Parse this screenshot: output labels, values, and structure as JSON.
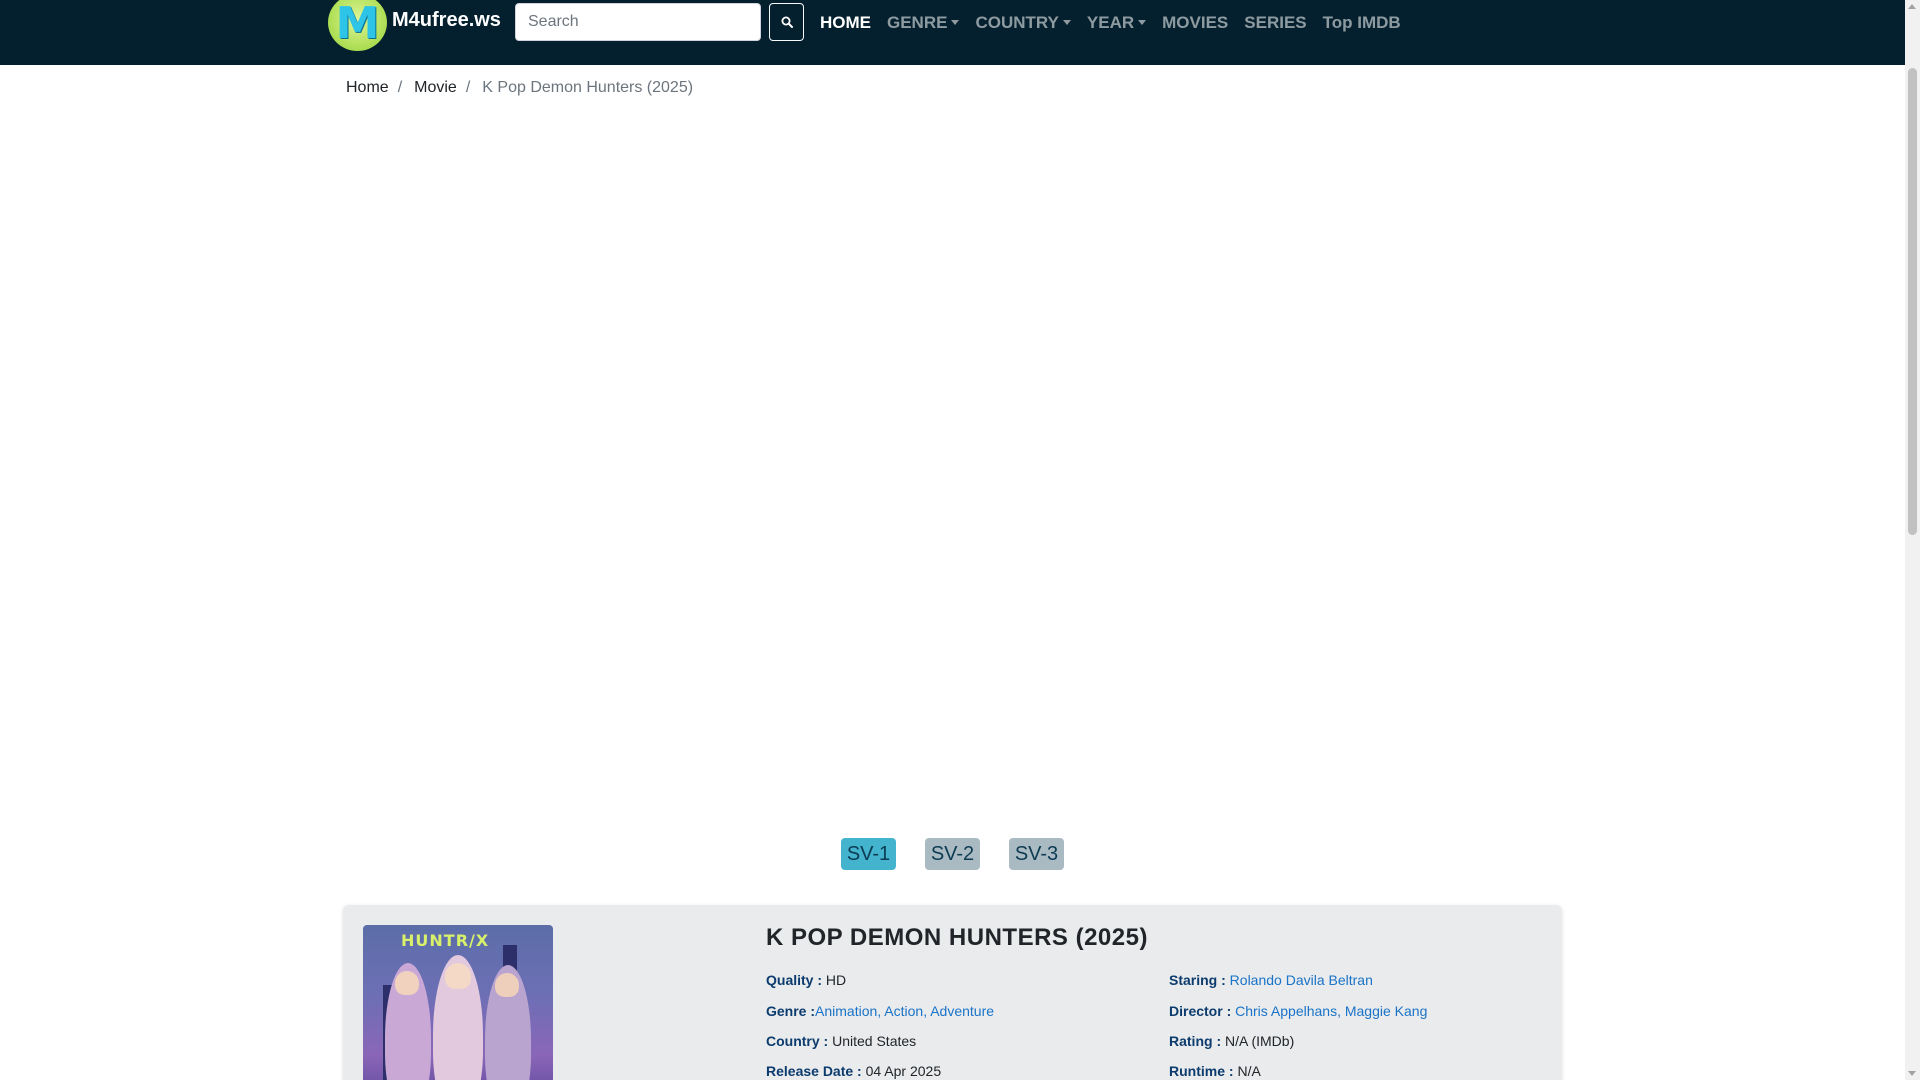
{
  "navbar": {
    "logo_letter": "M",
    "brand": "M4ufree.ws",
    "search_placeholder": "Search",
    "menu": [
      {
        "label": "HOME",
        "active": true,
        "dropdown": false
      },
      {
        "label": "GENRE",
        "active": false,
        "dropdown": true
      },
      {
        "label": "COUNTRY",
        "active": false,
        "dropdown": true
      },
      {
        "label": "YEAR",
        "active": false,
        "dropdown": true
      },
      {
        "label": "MOVIES",
        "active": false,
        "dropdown": false
      },
      {
        "label": "SERIES",
        "active": false,
        "dropdown": false
      },
      {
        "label": "Top IMDB",
        "active": false,
        "dropdown": false
      }
    ]
  },
  "breadcrumb": {
    "icon": "",
    "items": [
      "Home",
      "Movie",
      "K Pop Demon Hunters (2025)"
    ]
  },
  "servers": [
    "SV-1",
    "SV-2",
    "SV-3"
  ],
  "movie": {
    "poster_text": "HUNTR/X",
    "title": "K POP DEMON HUNTERS (2025)",
    "quality_label": "Quality :",
    "quality": "HD",
    "genre_label": "Genre :",
    "genre": "Animation, Action, Adventure",
    "country_label": "Country :",
    "country": "United States",
    "release_label": "Release Date :",
    "release": "04 Apr 2025",
    "staring_label": "Staring :",
    "staring": "Rolando Davila Beltran",
    "director_label": "Director :",
    "director": "Chris Appelhans, Maggie Kang",
    "rating_label": "Rating :",
    "rating": "N/A (IMDb)",
    "runtime_label": "Runtime :",
    "runtime": "N/A"
  },
  "colors": {
    "navbar_bg": "#04202e",
    "server_active": "#43b3ce",
    "server_inactive": "#a9bac2",
    "link": "#1a73c8",
    "label": "#0c3b6e"
  }
}
